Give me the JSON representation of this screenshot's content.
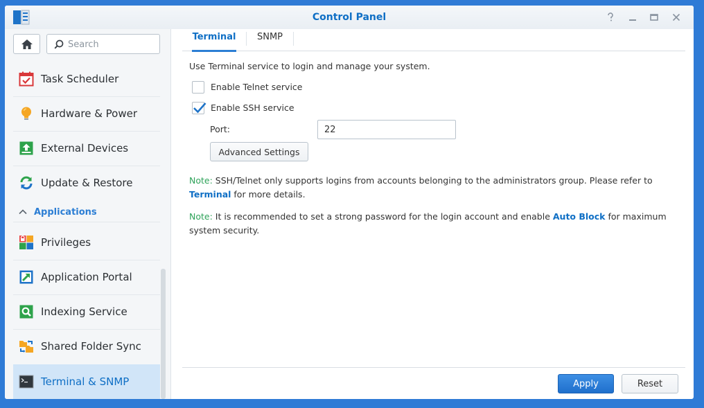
{
  "window": {
    "title": "Control Panel",
    "app_icon": "control-panel-icon",
    "controls": [
      "help-icon",
      "minimize-icon",
      "maximize-icon",
      "close-icon"
    ]
  },
  "sidebar": {
    "search_placeholder": "Search",
    "home_icon": "home-icon",
    "items": [
      {
        "label": "Task Scheduler",
        "icon": "calendar-check-icon"
      },
      {
        "label": "Hardware & Power",
        "icon": "lightbulb-icon"
      },
      {
        "label": "External Devices",
        "icon": "upload-drive-icon"
      },
      {
        "label": "Update & Restore",
        "icon": "refresh-icon"
      }
    ],
    "group": {
      "label": "Applications",
      "icon": "chevron-up-icon"
    },
    "app_items": [
      {
        "label": "Privileges",
        "icon": "privileges-grid-icon"
      },
      {
        "label": "Application Portal",
        "icon": "arrow-portal-icon"
      },
      {
        "label": "Indexing Service",
        "icon": "magnifier-icon"
      },
      {
        "label": "Shared Folder Sync",
        "icon": "folder-sync-icon"
      },
      {
        "label": "Terminal & SNMP",
        "icon": "terminal-icon",
        "active": true
      }
    ]
  },
  "tabs": [
    {
      "label": "Terminal",
      "active": true
    },
    {
      "label": "SNMP",
      "active": false
    }
  ],
  "terminal": {
    "intro": "Use Terminal service to login and manage your system.",
    "telnet": {
      "label": "Enable Telnet service",
      "checked": false
    },
    "ssh": {
      "label": "Enable SSH service",
      "checked": true
    },
    "port_label": "Port:",
    "port_value": "22",
    "advanced_button": "Advanced Settings",
    "note1": {
      "prefix": "Note:",
      "text_a": " SSH/Telnet only supports logins from accounts belonging to the administrators group. Please refer to",
      "link": "Terminal",
      "text_b": " for more details."
    },
    "note2": {
      "prefix": "Note:",
      "text_a": " It is recommended to set a strong password for the login account and enable ",
      "link": "Auto Block",
      "text_b": " for maximum",
      "text_c": "system security."
    }
  },
  "footer": {
    "apply_label": "Apply",
    "reset_label": "Reset"
  },
  "colors": {
    "accent": "#0f6fc5",
    "note": "#2fa35a",
    "desktop": "#2f7bd6"
  }
}
